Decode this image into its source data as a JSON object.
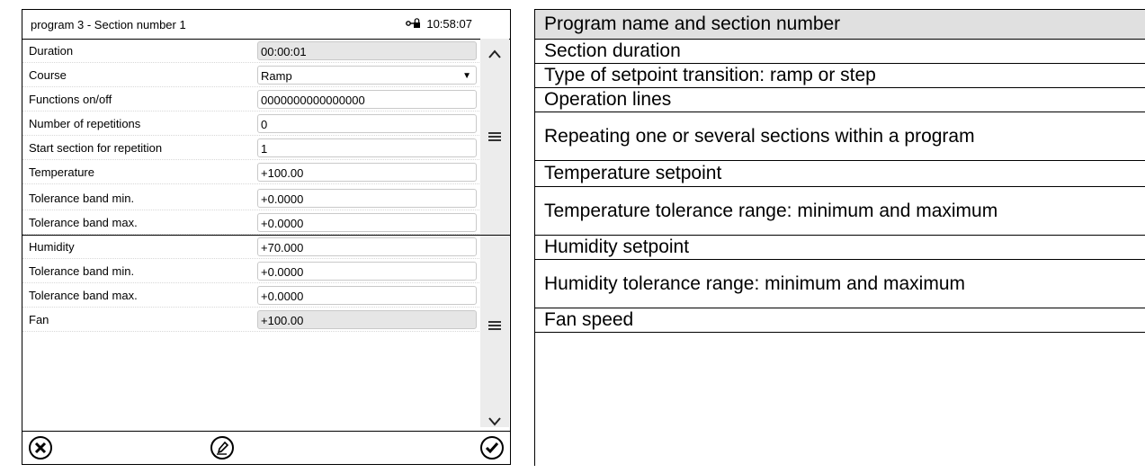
{
  "screen": {
    "title": "program 3 - Section number 1",
    "clock": "10:58:07",
    "clock_icon": "key-lock-icon",
    "rows": [
      {
        "label": "Duration",
        "value": "00:00:01",
        "readonly": true
      },
      {
        "label": "Course",
        "value": "Ramp",
        "dropdown": true
      },
      {
        "label": "Functions on/off",
        "value": "0000000000000000"
      },
      {
        "label": "Number of repetitions",
        "value": "0"
      },
      {
        "label": "Start section for repetition",
        "value": "1"
      },
      {
        "label": "Temperature",
        "value": "+100.00"
      },
      {
        "label": "Tolerance band min.",
        "value": "+0.0000"
      },
      {
        "label": "Tolerance band max.",
        "value": "+0.0000"
      },
      {
        "label": "Humidity",
        "value": "+70.000"
      },
      {
        "label": "Tolerance band min.",
        "value": "+0.0000"
      },
      {
        "label": "Tolerance band max.",
        "value": "+0.0000"
      },
      {
        "label": "Fan",
        "value": "+100.00",
        "readonly": true
      }
    ],
    "scroll_icons": {
      "up": "chevron-up-icon",
      "handle": "menu-lines-icon",
      "down": "chevron-down-icon"
    },
    "buttons": {
      "cancel": "cancel-icon",
      "edit": "edit-pencil-icon",
      "confirm": "check-icon"
    }
  },
  "descriptions": [
    "Program name and section number",
    "Section duration",
    "Type of setpoint transition: ramp or step",
    "Operation lines",
    "Repeating one or several sections within a program",
    "Temperature setpoint",
    "Temperature tolerance range: minimum and maximum",
    "Humidity setpoint",
    "Humidity tolerance range: minimum and maximum",
    "Fan speed"
  ]
}
